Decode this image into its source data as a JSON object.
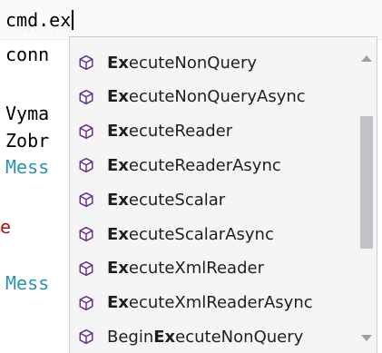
{
  "editor": {
    "line1_prefix": "cmd.ex",
    "line2": "conn",
    "line3": "Vyma",
    "line4": "Zobr",
    "line5": "Mess",
    "line6": "e",
    "line7": "Mess"
  },
  "completion": {
    "icon": "method-cube-icon",
    "icon_color": "#652d90",
    "items": [
      {
        "prefix": "",
        "match": "Ex",
        "suffix": "ecuteNonQuery"
      },
      {
        "prefix": "",
        "match": "Ex",
        "suffix": "ecuteNonQueryAsync"
      },
      {
        "prefix": "",
        "match": "Ex",
        "suffix": "ecuteReader"
      },
      {
        "prefix": "",
        "match": "Ex",
        "suffix": "ecuteReaderAsync"
      },
      {
        "prefix": "",
        "match": "Ex",
        "suffix": "ecuteScalar"
      },
      {
        "prefix": "",
        "match": "Ex",
        "suffix": "ecuteScalarAsync"
      },
      {
        "prefix": "",
        "match": "Ex",
        "suffix": "ecuteXmlReader"
      },
      {
        "prefix": "",
        "match": "Ex",
        "suffix": "ecuteXmlReaderAsync"
      },
      {
        "prefix": "Begin",
        "match": "Ex",
        "suffix": "ecuteNonQuery"
      }
    ]
  }
}
